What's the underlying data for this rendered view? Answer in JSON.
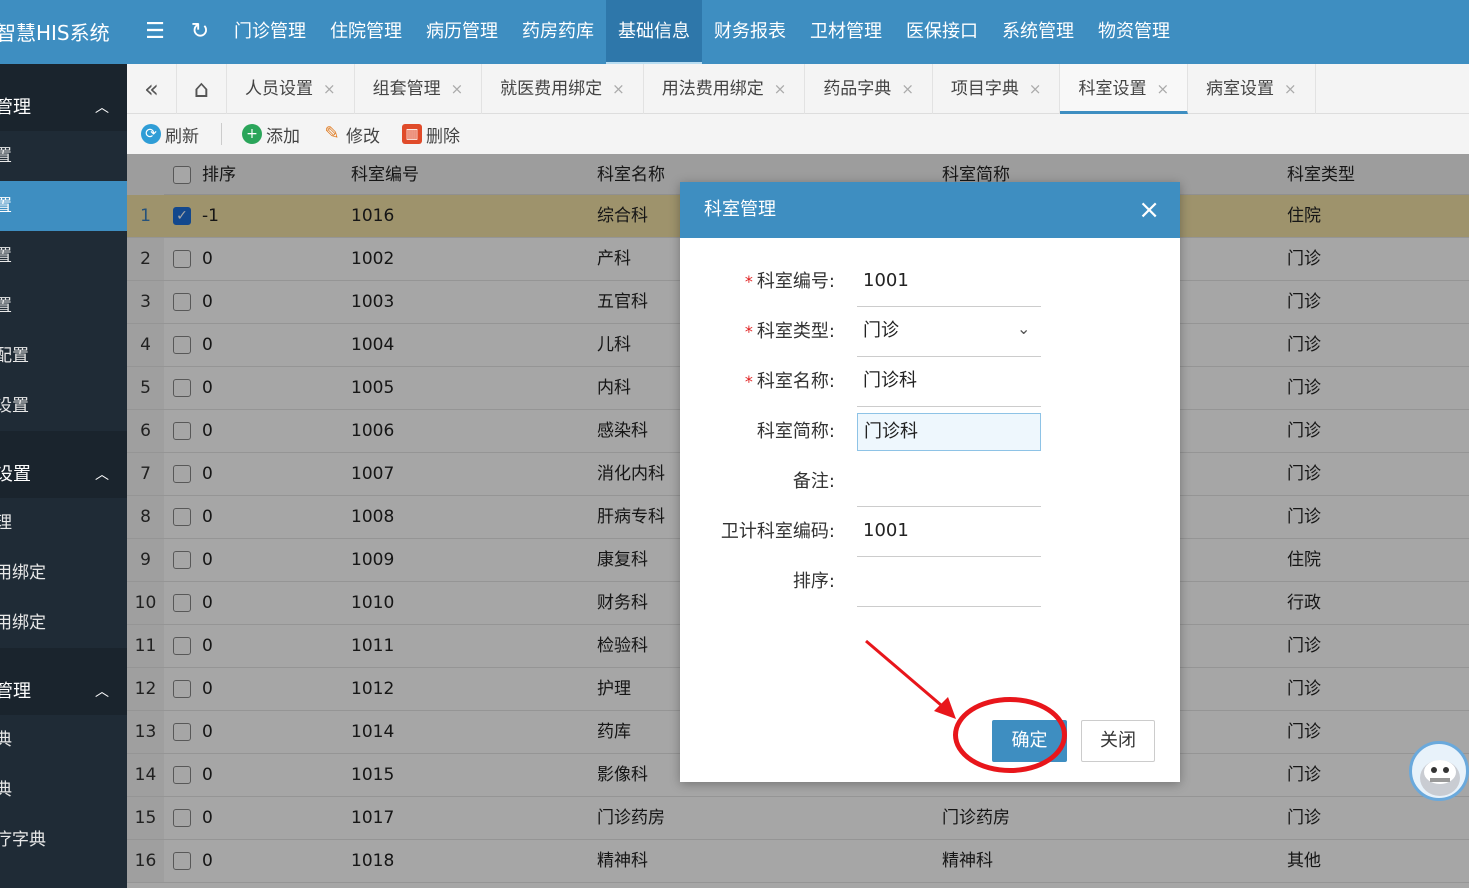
{
  "app": {
    "title": "智慧HIS系统"
  },
  "topbar": {
    "menu_icon": "menu-icon",
    "refresh_icon": "refresh-icon",
    "nav": [
      "门诊管理",
      "住院管理",
      "病历管理",
      "药房药库",
      "基础信息",
      "财务报表",
      "卫材管理",
      "医保接口",
      "系统管理",
      "物资管理"
    ],
    "active_nav": "基础信息"
  },
  "sidebar": {
    "groups": [
      {
        "label": "管理",
        "items": [
          "置",
          "置",
          "置",
          "置",
          "配置",
          "设置"
        ]
      },
      {
        "label": "设置",
        "items": [
          "理",
          "用绑定",
          "用绑定"
        ]
      },
      {
        "label": "管理",
        "items": [
          "典",
          "典",
          "疗字典"
        ]
      }
    ],
    "active_item": "置"
  },
  "tabs": {
    "items": [
      "人员设置",
      "组套管理",
      "就医费用绑定",
      "用法费用绑定",
      "药品字典",
      "项目字典",
      "科室设置",
      "病室设置"
    ],
    "active": "科室设置",
    "close_glyph": "×"
  },
  "toolbar": {
    "refresh": "刷新",
    "add": "添加",
    "edit": "修改",
    "delete": "删除"
  },
  "grid": {
    "columns": {
      "order": "排序",
      "code": "科室编号",
      "name": "科室名称",
      "short": "科室简称",
      "type": "科室类型"
    },
    "rows": [
      {
        "n": "1",
        "order": "-1",
        "code": "1016",
        "name": "综合科",
        "short": "",
        "type": "住院",
        "checked": true
      },
      {
        "n": "2",
        "order": "0",
        "code": "1002",
        "name": "产科",
        "short": "",
        "type": "门诊"
      },
      {
        "n": "3",
        "order": "0",
        "code": "1003",
        "name": "五官科",
        "short": "",
        "type": "门诊"
      },
      {
        "n": "4",
        "order": "0",
        "code": "1004",
        "name": "儿科",
        "short": "",
        "type": "门诊"
      },
      {
        "n": "5",
        "order": "0",
        "code": "1005",
        "name": "内科",
        "short": "",
        "type": "门诊"
      },
      {
        "n": "6",
        "order": "0",
        "code": "1006",
        "name": "感染科",
        "short": "",
        "type": "门诊"
      },
      {
        "n": "7",
        "order": "0",
        "code": "1007",
        "name": "消化内科",
        "short": "",
        "type": "门诊"
      },
      {
        "n": "8",
        "order": "0",
        "code": "1008",
        "name": "肝病专科",
        "short": "",
        "type": "门诊"
      },
      {
        "n": "9",
        "order": "0",
        "code": "1009",
        "name": "康复科",
        "short": "",
        "type": "住院"
      },
      {
        "n": "10",
        "order": "0",
        "code": "1010",
        "name": "财务科",
        "short": "",
        "type": "行政"
      },
      {
        "n": "11",
        "order": "0",
        "code": "1011",
        "name": "检验科",
        "short": "",
        "type": "门诊"
      },
      {
        "n": "12",
        "order": "0",
        "code": "1012",
        "name": "护理",
        "short": "",
        "type": "门诊"
      },
      {
        "n": "13",
        "order": "0",
        "code": "1014",
        "name": "药库",
        "short": "",
        "type": "门诊"
      },
      {
        "n": "14",
        "order": "0",
        "code": "1015",
        "name": "影像科",
        "short": "",
        "type": "门诊"
      },
      {
        "n": "15",
        "order": "0",
        "code": "1017",
        "name": "门诊药房",
        "short": "门诊药房",
        "type": "门诊"
      },
      {
        "n": "16",
        "order": "0",
        "code": "1018",
        "name": "精神科",
        "short": "精神科",
        "type": "其他"
      }
    ]
  },
  "modal": {
    "title": "科室管理",
    "fields": [
      {
        "label": "科室编号:",
        "value": "1001",
        "required": true
      },
      {
        "label": "科室类型:",
        "value": "门诊",
        "required": true,
        "select": true
      },
      {
        "label": "科室名称:",
        "value": "门诊科",
        "required": true
      },
      {
        "label": "科室简称:",
        "value": "门诊科",
        "required": false,
        "focused": true
      },
      {
        "label": "备注:",
        "value": "",
        "required": false
      },
      {
        "label": "卫计科室编码:",
        "value": "1001",
        "required": false
      },
      {
        "label": "排序:",
        "value": "",
        "required": false
      }
    ],
    "required_mark": "*",
    "ok": "确定",
    "close": "关闭"
  },
  "colors": {
    "primary": "#3e8ec1",
    "sidebar": "#1f2b36",
    "selected_row": "#f3e2a6",
    "annotation": "#e8161b"
  }
}
